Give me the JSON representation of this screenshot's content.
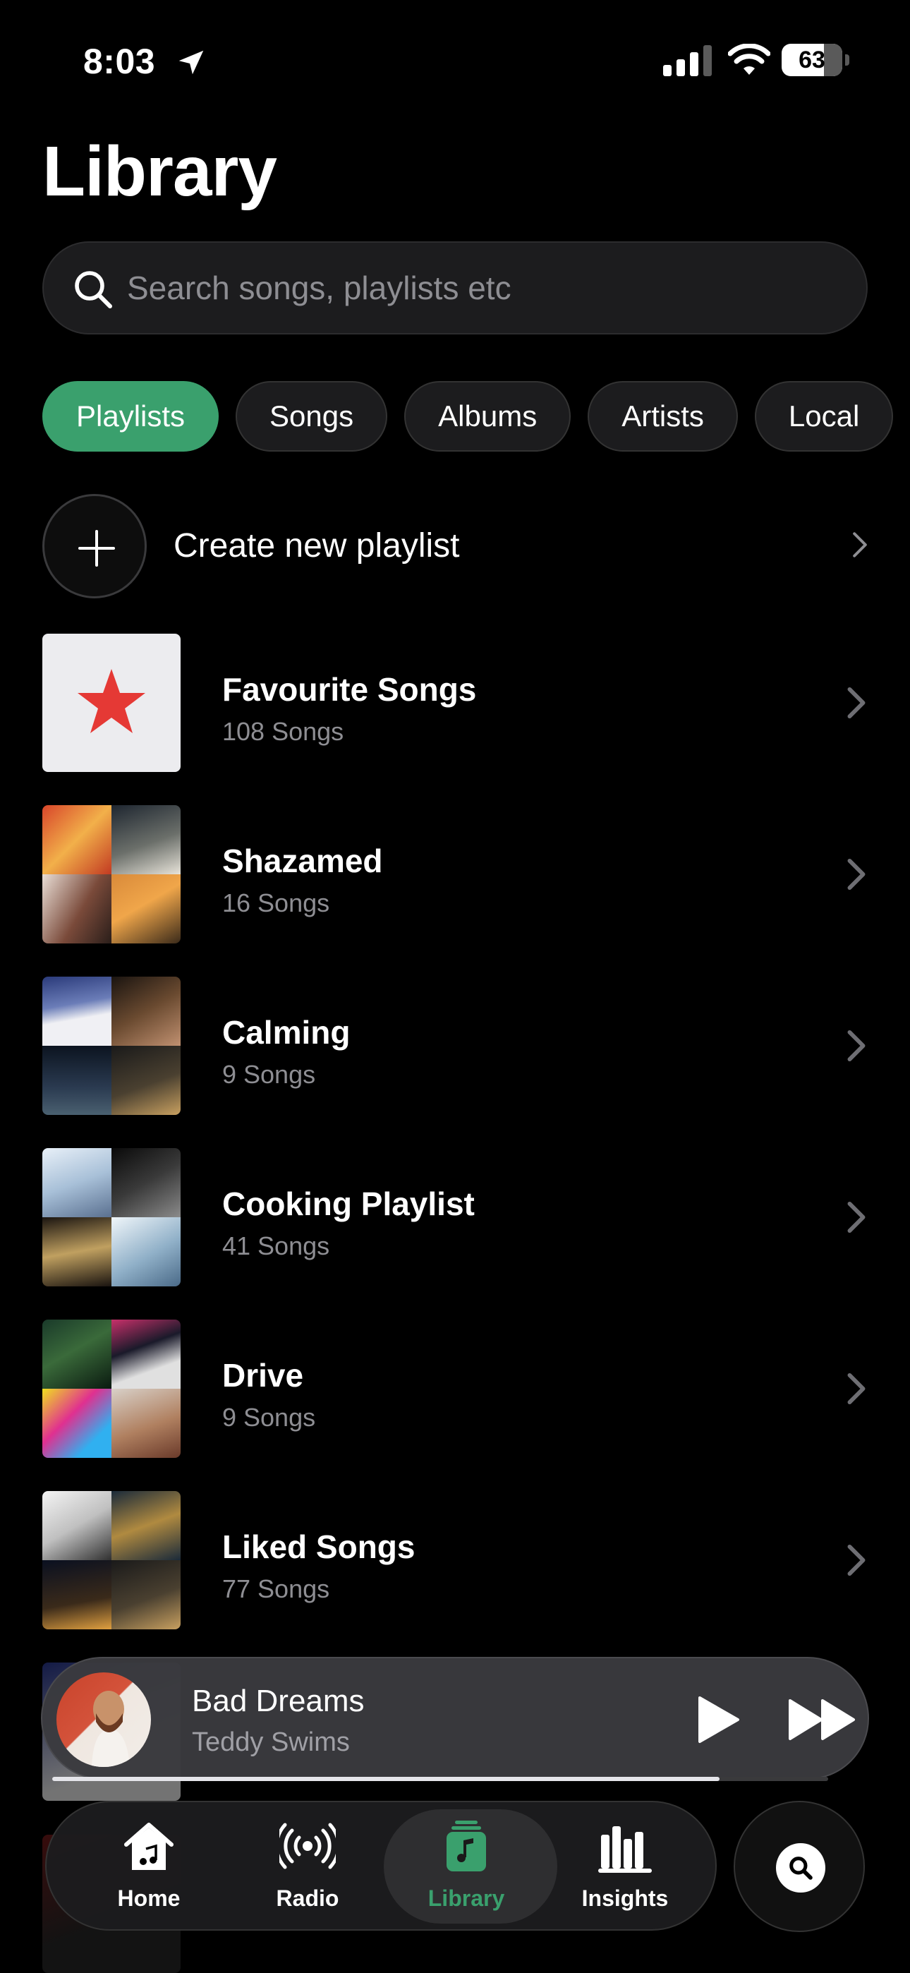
{
  "status": {
    "time": "8:03",
    "battery": "63"
  },
  "title": "Library",
  "search": {
    "placeholder": "Search songs, playlists etc"
  },
  "chips": [
    "Playlists",
    "Songs",
    "Albums",
    "Artists",
    "Local"
  ],
  "active_chip": "Playlists",
  "create": {
    "label": "Create new playlist"
  },
  "playlists": [
    {
      "name": "Favourite Songs",
      "count": "108 Songs"
    },
    {
      "name": "Shazamed",
      "count": "16 Songs"
    },
    {
      "name": "Calming",
      "count": "9 Songs"
    },
    {
      "name": "Cooking Playlist",
      "count": "41 Songs"
    },
    {
      "name": "Drive",
      "count": "9 Songs"
    },
    {
      "name": "Liked Songs",
      "count": "77 Songs"
    }
  ],
  "now_playing": {
    "title": "Bad Dreams",
    "artist": "Teddy Swims",
    "progress": 0.86
  },
  "tabs": [
    {
      "label": "Home",
      "icon": "home-icon"
    },
    {
      "label": "Radio",
      "icon": "radio-icon"
    },
    {
      "label": "Library",
      "icon": "library-icon"
    },
    {
      "label": "Insights",
      "icon": "insights-icon"
    }
  ],
  "active_tab": "Library",
  "colors": {
    "accent": "#3aa06d",
    "favourite_star": "#e53935",
    "background": "#000000"
  }
}
